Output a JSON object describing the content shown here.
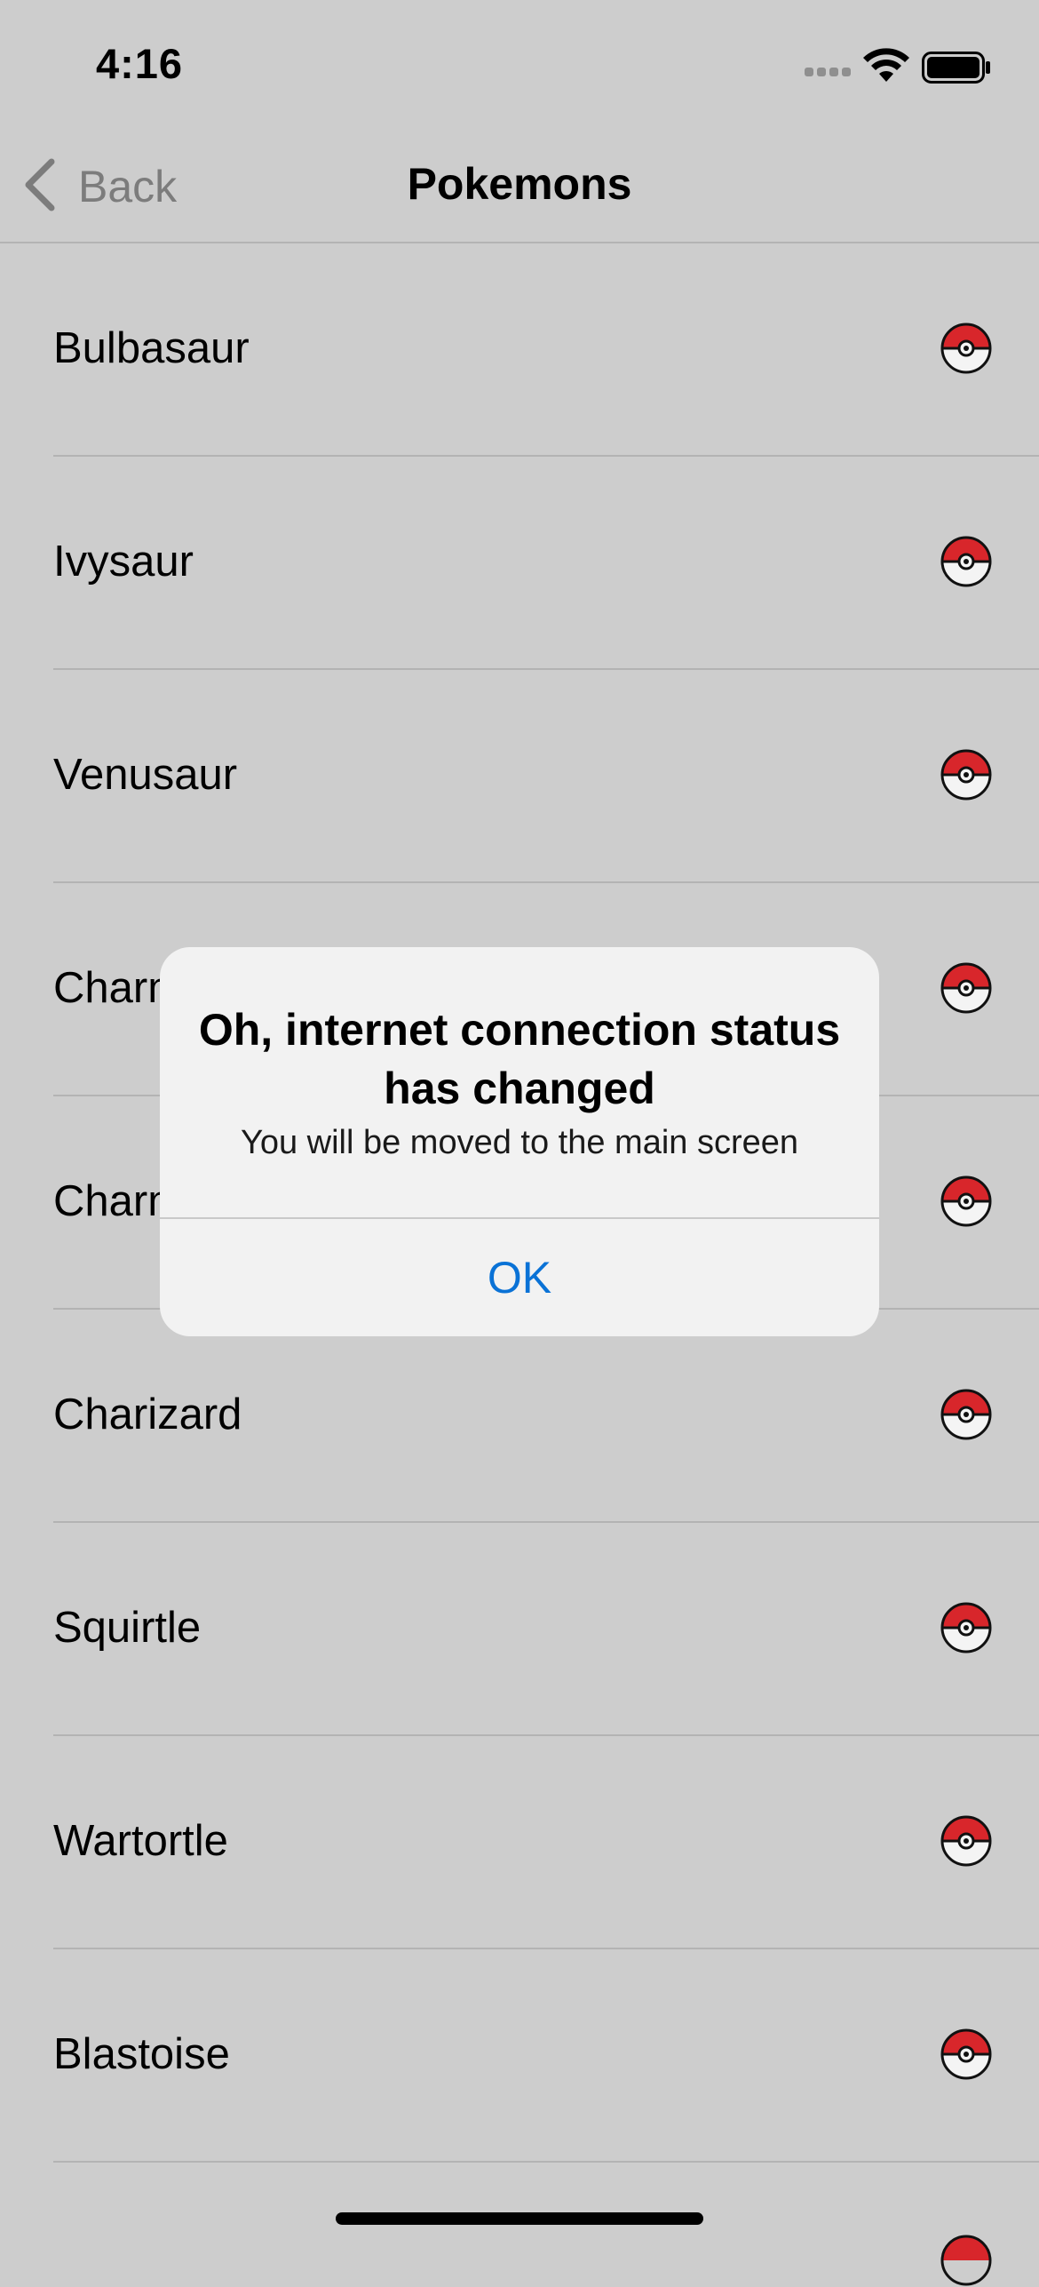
{
  "status_bar": {
    "time": "4:16",
    "icons": [
      "cellular-signal-icon",
      "wifi-icon",
      "battery-icon"
    ]
  },
  "nav": {
    "back_label": "Back",
    "title": "Pokemons"
  },
  "list": {
    "items": [
      {
        "name": "Bulbasaur",
        "icon": "pokeball-icon"
      },
      {
        "name": "Ivysaur",
        "icon": "pokeball-icon"
      },
      {
        "name": "Venusaur",
        "icon": "pokeball-icon"
      },
      {
        "name": "Charmander",
        "icon": "pokeball-icon"
      },
      {
        "name": "Charmeleon",
        "icon": "pokeball-icon"
      },
      {
        "name": "Charizard",
        "icon": "pokeball-icon"
      },
      {
        "name": "Squirtle",
        "icon": "pokeball-icon"
      },
      {
        "name": "Wartortle",
        "icon": "pokeball-icon"
      },
      {
        "name": "Blastoise",
        "icon": "pokeball-icon"
      }
    ]
  },
  "alert": {
    "title": "Oh, internet connection status has changed",
    "message": "You will be moved to the main screen",
    "ok_label": "OK"
  },
  "colors": {
    "accent": "#0a72d6",
    "pokeball_red": "#d8262b",
    "background_dimmed": "#cdcdcd"
  }
}
